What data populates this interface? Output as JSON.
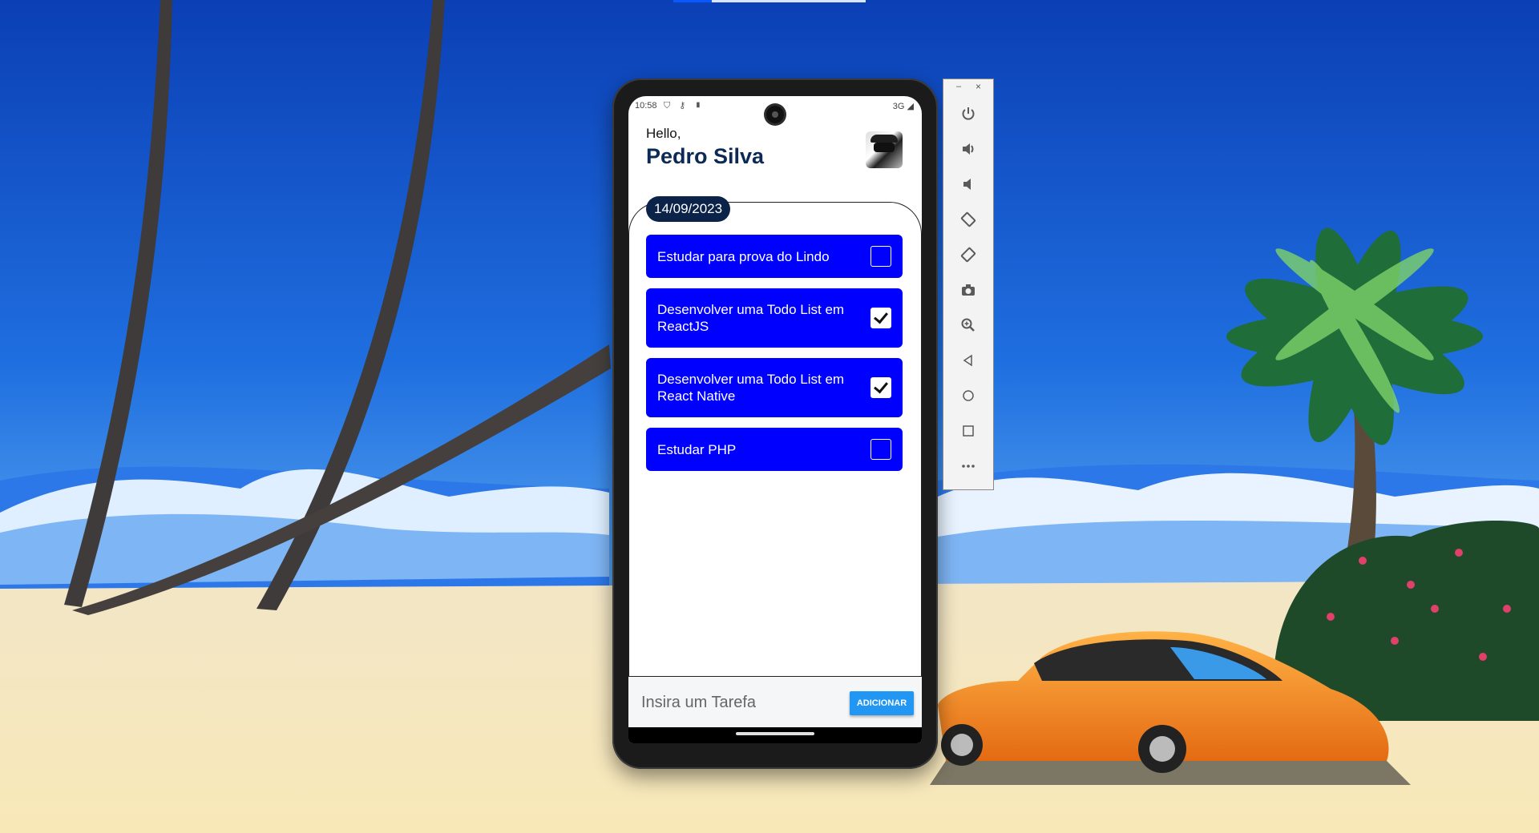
{
  "status": {
    "time": "10:58",
    "network": "3G"
  },
  "header": {
    "greeting": "Hello,",
    "name": "Pedro Silva"
  },
  "date": "14/09/2023",
  "tasks": [
    {
      "text": "Estudar para prova do Lindo",
      "done": false
    },
    {
      "text": "Desenvolver uma Todo List em ReactJS",
      "done": true
    },
    {
      "text": "Desenvolver uma Todo List em React Native",
      "done": true
    },
    {
      "text": "Estudar PHP",
      "done": false
    }
  ],
  "input": {
    "placeholder": "Insira um Tarefa",
    "value": ""
  },
  "add_button": "ADICIONAR",
  "emulator": {
    "minimize": "–",
    "close": "×",
    "buttons": [
      "power-icon",
      "volume-up-icon",
      "volume-down-icon",
      "rotate-left-icon",
      "rotate-right-icon",
      "camera-icon",
      "zoom-icon",
      "back-icon",
      "home-icon",
      "overview-icon",
      "more-icon"
    ]
  },
  "colors": {
    "task_bg": "#0000ff",
    "date_badge": "#0b2348",
    "add_button": "#2196f3",
    "name_text": "#0b2a55"
  }
}
